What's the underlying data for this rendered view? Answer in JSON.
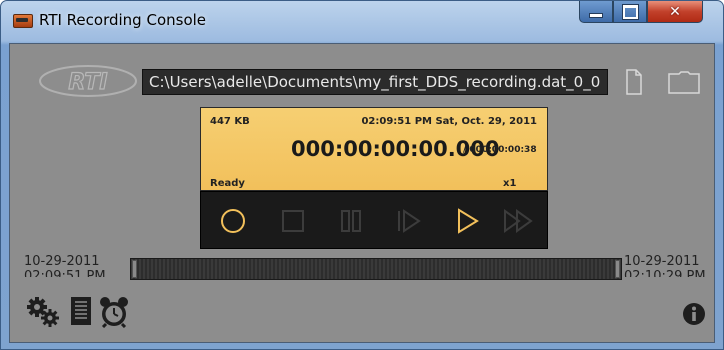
{
  "window": {
    "title": "RTI Recording Console",
    "icon": "recorder-app-icon",
    "controls": [
      "minimize-icon",
      "maximize-icon",
      "close-icon"
    ]
  },
  "header": {
    "logo_text": "RTI",
    "file_path": "C:\\Users\\adelle\\Documents\\my_first_DDS_recording.dat_0_0",
    "icons": [
      "file-icon",
      "folder-icon"
    ]
  },
  "display": {
    "size": "447 KB",
    "clock": "02:09:51 PM  Sat, Oct. 29, 2011",
    "elapsed": "000:00:00:00.000",
    "total": "/ 000:00:00:38",
    "status": "Ready",
    "speed": "x1"
  },
  "transport": {
    "buttons": [
      "record-icon",
      "stop-icon",
      "pause-icon",
      "step-icon",
      "play-icon",
      "fast-forward-icon"
    ]
  },
  "timeline": {
    "start_date": "10-29-2011",
    "start_time": "02:09:51 PM",
    "end_date": "10-29-2011",
    "end_time": "02:10:29 PM"
  },
  "toolbar": {
    "icons": [
      "settings-icon",
      "notes-icon",
      "alarm-clock-icon",
      "info-icon"
    ]
  },
  "colors": {
    "display_bg": "#f2c05b",
    "panel_bg": "#8d8d8d",
    "transport_bg": "#1a1a1a",
    "record_accent": "#f2c05b"
  }
}
